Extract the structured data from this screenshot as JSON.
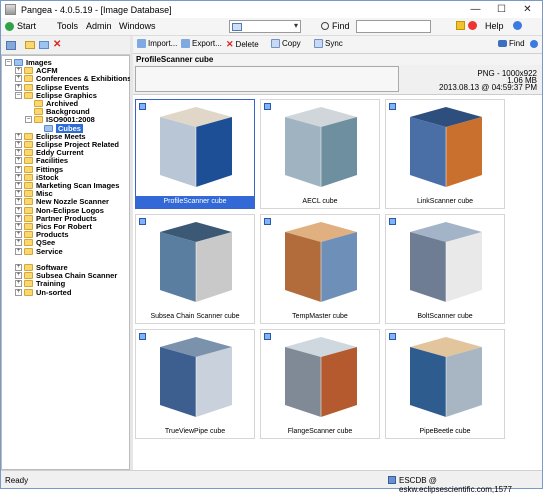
{
  "window": {
    "title": "Pangea - 4.0.5.19 - [Image Database]",
    "min": "—",
    "max": "☐",
    "close": "✕"
  },
  "menu": {
    "start": "Start",
    "tools": "Tools",
    "admin": "Admin",
    "windows": "Windows",
    "find": "Find",
    "help": "Help"
  },
  "toolbar": {
    "import": "Import...",
    "export": "Export...",
    "delete": "Delete",
    "copy": "Copy",
    "sync": "Sync",
    "find": "Find"
  },
  "tree": {
    "root": "Images",
    "items": [
      "ACFM",
      "Conferences & Exhibitions",
      "Eclipse Events",
      "Eclipse Graphics",
      "Archived",
      "Background",
      "ISO9001:2008",
      "Cubes",
      "Eclipse Meets",
      "Eclipse Project Related",
      "Eddy Current",
      "Facilities",
      "Fittings",
      "iStock",
      "Marketing Scan Images",
      "Misc",
      "New Nozzle Scanner",
      "Non-Eclipse Logos",
      "Partner Products",
      "Pics For Robert",
      "Products",
      "QSee",
      "Service",
      "",
      "Software",
      "Subsea Chain Scanner",
      "Training",
      "Un-sorted"
    ]
  },
  "selected": {
    "name": "ProfileScanner cube",
    "format": "PNG - 1000x922",
    "size": "1.06 MB",
    "date": "2013.08.13 @ 04:59:37 PM"
  },
  "thumbnails": [
    "ProfileScanner cube",
    "AECL cube",
    "LinkScanner cube",
    "Subsea Chain Scanner cube",
    "TempMaster cube",
    "BoltScanner cube",
    "TrueViewPipe cube",
    "FlangeScanner cube",
    "PipeBeetle cube"
  ],
  "status": {
    "left": "Ready",
    "right": "ESCDB @ eskw.eclipsescientific.com,1577"
  },
  "colors": {
    "accent": "#3269d6",
    "folder": "#fcd86c"
  }
}
